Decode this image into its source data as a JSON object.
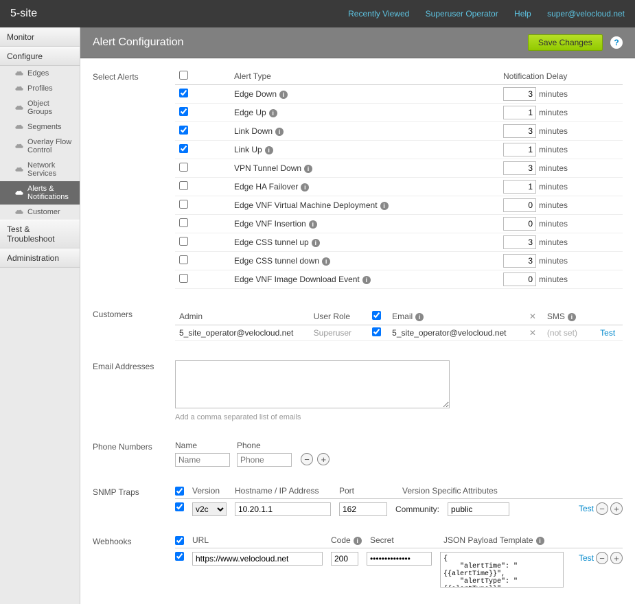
{
  "brand": "5-site",
  "topbar": {
    "recently_viewed": "Recently Viewed",
    "role": "Superuser Operator",
    "help": "Help",
    "user": "super@velocloud.net"
  },
  "sidebar": {
    "monitor": "Monitor",
    "configure": "Configure",
    "items": [
      {
        "label": "Edges"
      },
      {
        "label": "Profiles"
      },
      {
        "label": "Object Groups"
      },
      {
        "label": "Segments"
      },
      {
        "label": "Overlay Flow Control"
      },
      {
        "label": "Network Services"
      },
      {
        "label": "Alerts & Notifications"
      },
      {
        "label": "Customer"
      }
    ],
    "test": "Test & Troubleshoot",
    "admin": "Administration"
  },
  "page": {
    "title": "Alert Configuration",
    "save": "Save Changes"
  },
  "alerts": {
    "section_label": "Select Alerts",
    "col_type": "Alert Type",
    "col_delay": "Notification Delay",
    "unit": "minutes",
    "rows": [
      {
        "checked": true,
        "label": "Edge Down",
        "info": true,
        "delay": "3"
      },
      {
        "checked": true,
        "label": "Edge Up",
        "info": true,
        "delay": "1"
      },
      {
        "checked": true,
        "label": "Link Down",
        "info": true,
        "delay": "3"
      },
      {
        "checked": true,
        "label": "Link Up",
        "info": true,
        "delay": "1"
      },
      {
        "checked": false,
        "label": "VPN Tunnel Down",
        "info": true,
        "delay": "3"
      },
      {
        "checked": false,
        "label": "Edge HA Failover",
        "info": true,
        "delay": "1"
      },
      {
        "checked": false,
        "label": "Edge VNF Virtual Machine Deployment",
        "info": true,
        "delay": "0"
      },
      {
        "checked": false,
        "label": "Edge VNF Insertion",
        "info": true,
        "delay": "0"
      },
      {
        "checked": false,
        "label": "Edge CSS tunnel up",
        "info": true,
        "delay": "3"
      },
      {
        "checked": false,
        "label": "Edge CSS tunnel down",
        "info": true,
        "delay": "3"
      },
      {
        "checked": false,
        "label": "Edge VNF Image Download Event",
        "info": true,
        "delay": "0"
      }
    ]
  },
  "customers": {
    "section_label": "Customers",
    "col_admin": "Admin",
    "col_role": "User Role",
    "col_email": "Email",
    "col_sms": "SMS",
    "test": "Test",
    "row": {
      "admin": "5_site_operator@velocloud.net",
      "role": "Superuser",
      "email_checked": true,
      "email": "5_site_operator@velocloud.net",
      "sms": "(not set)"
    }
  },
  "emails": {
    "section_label": "Email Addresses",
    "hint": "Add a comma separated list of emails"
  },
  "phones": {
    "section_label": "Phone Numbers",
    "name_label": "Name",
    "phone_label": "Phone",
    "name_ph": "Name",
    "phone_ph": "Phone"
  },
  "snmp": {
    "section_label": "SNMP Traps",
    "col_version": "Version",
    "col_host": "Hostname / IP Address",
    "col_port": "Port",
    "col_attrs": "Version Specific Attributes",
    "community_label": "Community:",
    "version": "v2c",
    "host": "10.20.1.1",
    "port": "162",
    "community": "public",
    "test": "Test"
  },
  "webhooks": {
    "section_label": "Webhooks",
    "col_url": "URL",
    "col_code": "Code",
    "col_secret": "Secret",
    "col_template": "JSON Payload Template",
    "url": "https://www.velocloud.net",
    "code": "200",
    "secret": "••••••••••••••",
    "template": "{\n    \"alertTime\": \"{{alertTime}}\",\n    \"alertType\": \"{{alertType}}\",\n    \"customer\": \"{{customer}}\",",
    "test": "Test"
  }
}
